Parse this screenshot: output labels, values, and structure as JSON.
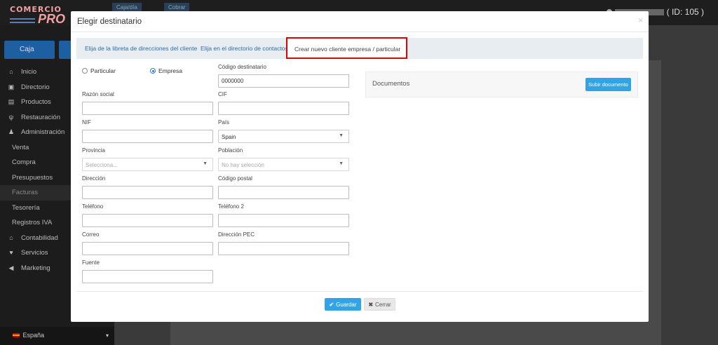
{
  "app": {
    "brand_top": "COMERCIO",
    "brand_bottom": "PRO",
    "top_tabs": [
      "Caja/día",
      "Cobrar"
    ],
    "user_id_text": "( ID: 105 )",
    "caja_label": "Caja",
    "sidebar": [
      {
        "label": "Inicio",
        "icon": "home-icon",
        "glyph": "⌂"
      },
      {
        "label": "Directorio",
        "icon": "contacts-icon",
        "glyph": "▣"
      },
      {
        "label": "Productos",
        "icon": "box-icon",
        "glyph": "▤"
      },
      {
        "label": "Restauración",
        "icon": "fork-knife-icon",
        "glyph": "ψ"
      },
      {
        "label": "Administración",
        "icon": "users-icon",
        "glyph": "♟"
      },
      {
        "label": "Venta",
        "sub": true
      },
      {
        "label": "Compra",
        "sub": true
      },
      {
        "label": "Presupuestos",
        "sub": true
      },
      {
        "label": "Facturas",
        "sub": true,
        "active": true
      },
      {
        "label": "Tesorería",
        "sub": true
      },
      {
        "label": "Registros IVA",
        "sub": true
      },
      {
        "label": "Contabilidad",
        "icon": "bank-icon",
        "glyph": "⌂"
      },
      {
        "label": "Servicios",
        "icon": "heart-icon",
        "glyph": "♥"
      },
      {
        "label": "Marketing",
        "icon": "megaphone-icon",
        "glyph": "◀"
      }
    ],
    "language": "España"
  },
  "modal": {
    "title": "Elegir destinatario",
    "close_glyph": "×",
    "tabs": [
      {
        "label": "Elija de la libreta de direcciones del cliente"
      },
      {
        "label": "Elija en el directorio de contactos"
      },
      {
        "label": "Crear nuevo cliente empresa / particular",
        "active": true
      }
    ],
    "radio": {
      "options": [
        "Particular",
        "Empresa"
      ],
      "selected": "Empresa"
    },
    "fields": {
      "codigo_destinatario": {
        "label": "Código destinatario",
        "value": "0000000"
      },
      "razon_social": {
        "label": "Razón social",
        "value": ""
      },
      "cif": {
        "label": "CIF",
        "value": ""
      },
      "nif": {
        "label": "NIF",
        "value": ""
      },
      "pais": {
        "label": "País",
        "value": "Spain"
      },
      "provincia": {
        "label": "Provincia",
        "placeholder": "Selecciona..."
      },
      "poblacion": {
        "label": "Población",
        "placeholder": "No hay selección"
      },
      "direccion": {
        "label": "Dirección",
        "value": ""
      },
      "codigo_postal": {
        "label": "Código postal",
        "value": ""
      },
      "telefono": {
        "label": "Teléfono",
        "value": ""
      },
      "telefono2": {
        "label": "Teléfono 2",
        "value": ""
      },
      "correo": {
        "label": "Correo",
        "value": ""
      },
      "direccion_pec": {
        "label": "Dirección PEC",
        "value": ""
      },
      "fuente": {
        "label": "Fuente",
        "value": ""
      }
    },
    "documents": {
      "title": "Documentos",
      "upload_label": "Subir documento"
    },
    "footer": {
      "save_label": "Guardar",
      "cancel_label": "Cerrar"
    }
  },
  "colors": {
    "accent": "#2fa5e8",
    "highlight_border": "#e60000",
    "tab_link": "#2a6db0"
  }
}
